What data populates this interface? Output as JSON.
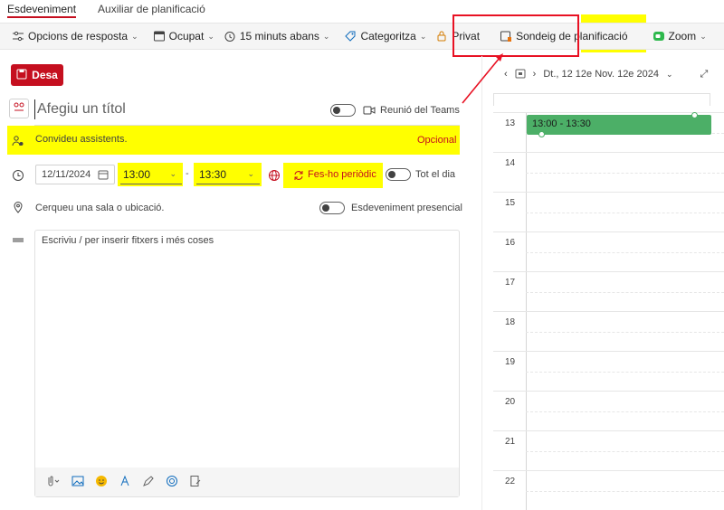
{
  "tabs": [
    {
      "label": "Esdeveniment",
      "active": true
    },
    {
      "label": "Auxiliar de planificació",
      "active": false
    }
  ],
  "toolbar": {
    "response_options": "Opcions de resposta",
    "busy": "Ocupat",
    "reminder": "15 minuts abans",
    "categorize": "Categoritza",
    "private": "Privat",
    "scheduling_poll": "Sondeig de planificació",
    "zoom": "Zoom",
    "more": "···"
  },
  "save_label": "Desa",
  "title_placeholder": "Afegiu un títol",
  "teams_label": "Reunió del Teams",
  "attendees_placeholder": "Convideu assistents.",
  "optional_label": "Opcional",
  "date_value": "12/11/2024",
  "start_time": "13:00",
  "end_time": "13:30",
  "time_separator": "-",
  "recurring_label": "Fes-ho periòdic",
  "all_day_label": "Tot el dia",
  "location_placeholder": "Cerqueu una sala o ubicació.",
  "in_person_label": "Esdeveniment presencial",
  "body_placeholder": "Escriviu / per inserir fitxers i més coses",
  "calendar": {
    "date_label": "Dt., 12 12e Nov. 12e 2024",
    "hours": [
      "13",
      "14",
      "15",
      "16",
      "17",
      "18",
      "19",
      "20",
      "21",
      "22"
    ],
    "event_label": "13:00 - 13:30"
  },
  "colors": {
    "accent": "#c50f1f",
    "highlight": "#ffff00",
    "event": "#4caf67",
    "annotation": "#e81123"
  }
}
